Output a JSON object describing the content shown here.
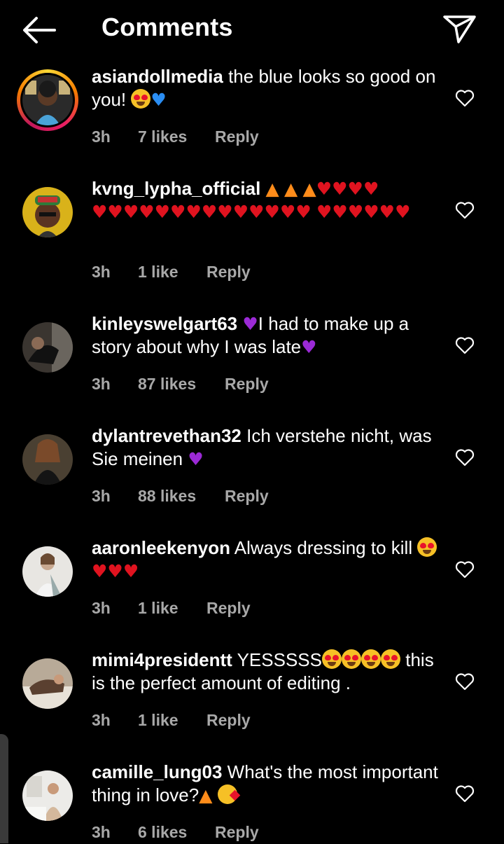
{
  "header": {
    "title": "Comments",
    "back_icon": "arrow-left-icon",
    "share_icon": "paper-plane-icon"
  },
  "comments": [
    {
      "username": "asiandollmedia",
      "text": "the blue looks so good on you!",
      "emojis": "😍💙",
      "time": "3h",
      "likes": "7 likes",
      "reply": "Reply"
    },
    {
      "username": "kvng_lypha_official",
      "text": "",
      "emojis": "🔥🔥🔥❤️❤️❤️❤️❤️❤️❤️❤️❤️❤️❤️❤️❤️❤️❤️❤️❤️❤️❤️❤️❤️❤️❤️❤️",
      "time": "3h",
      "likes": "1 like",
      "reply": "Reply"
    },
    {
      "username": "kinleyswelgart63",
      "text": "I had to make up a story about why I was late",
      "emojis": "💜💜",
      "time": "3h",
      "likes": "87 likes",
      "reply": "Reply"
    },
    {
      "username": "dylantrevethan32",
      "text": "Ich verstehe nicht, was Sie meinen",
      "emojis": "💜",
      "time": "3h",
      "likes": "88 likes",
      "reply": "Reply"
    },
    {
      "username": "aaronleekenyon",
      "text": "Always dressing to kill",
      "emojis": "😍❤️❤️❤️",
      "time": "3h",
      "likes": "1 like",
      "reply": "Reply"
    },
    {
      "username": "mimi4presidentt",
      "text": "YESSSSS",
      "text2": "this is the perfect amount of editing .",
      "emojis": "😍😍😍😍",
      "time": "3h",
      "likes": "1 like",
      "reply": "Reply"
    },
    {
      "username": "camille_lung03",
      "text": "What's the most important thing in love?",
      "emojis": "🔥😘",
      "time": "3h",
      "likes": "6 likes",
      "reply": "Reply"
    }
  ]
}
